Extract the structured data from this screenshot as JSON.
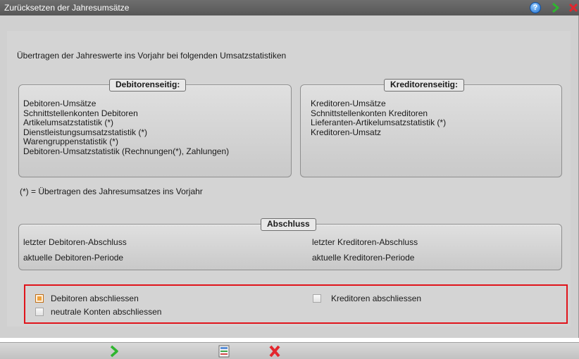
{
  "window": {
    "title": "Zurücksetzen der Jahresumsätze"
  },
  "intro": "Übertragen der Jahreswerte ins Vorjahr bei folgenden Umsatzstatistiken",
  "debitoren": {
    "heading": "Debitorenseitig:",
    "items": [
      "Debitoren-Umsätze",
      "Schnittstellenkonten Debitoren",
      "Artikelumsatzstatistik (*)",
      "Dienstleistungsumsatzstatistik (*)",
      "Warengruppenstatistik (*)",
      "Debitoren-Umsatzstatistik (Rechnungen(*), Zahlungen)"
    ]
  },
  "kreditoren": {
    "heading": "Kreditorenseitig:",
    "items": [
      "Kreditoren-Umsätze",
      "Schnittstellenkonten Kreditoren",
      "Lieferanten-Artikelumsatzstatistik (*)",
      "Kreditoren-Umsatz"
    ]
  },
  "note": "(*) = Übertragen des Jahresumsatzes ins Vorjahr",
  "abschluss": {
    "heading": "Abschluss",
    "left": [
      "letzter Debitoren-Abschluss",
      "aktuelle Debitoren-Periode"
    ],
    "right": [
      "letzter Kreditoren-Abschluss",
      "aktuelle Kreditoren-Periode"
    ]
  },
  "options": {
    "debitoren_label": "Debitoren abschliessen",
    "debitoren_checked": true,
    "kreditoren_label": "Kreditoren abschliessen",
    "kreditoren_checked": false,
    "neutrale_label": "neutrale Konten abschliessen",
    "neutrale_checked": false
  },
  "icons": {
    "help": "help-icon",
    "go": "arrow-right-icon",
    "close": "close-icon",
    "save": "save-icon"
  },
  "colors": {
    "titlebar": "#575757",
    "highlight_border": "#e0141b",
    "checked": "#f2a13a",
    "go_green": "#2fb52f",
    "close_red": "#e3262d"
  }
}
